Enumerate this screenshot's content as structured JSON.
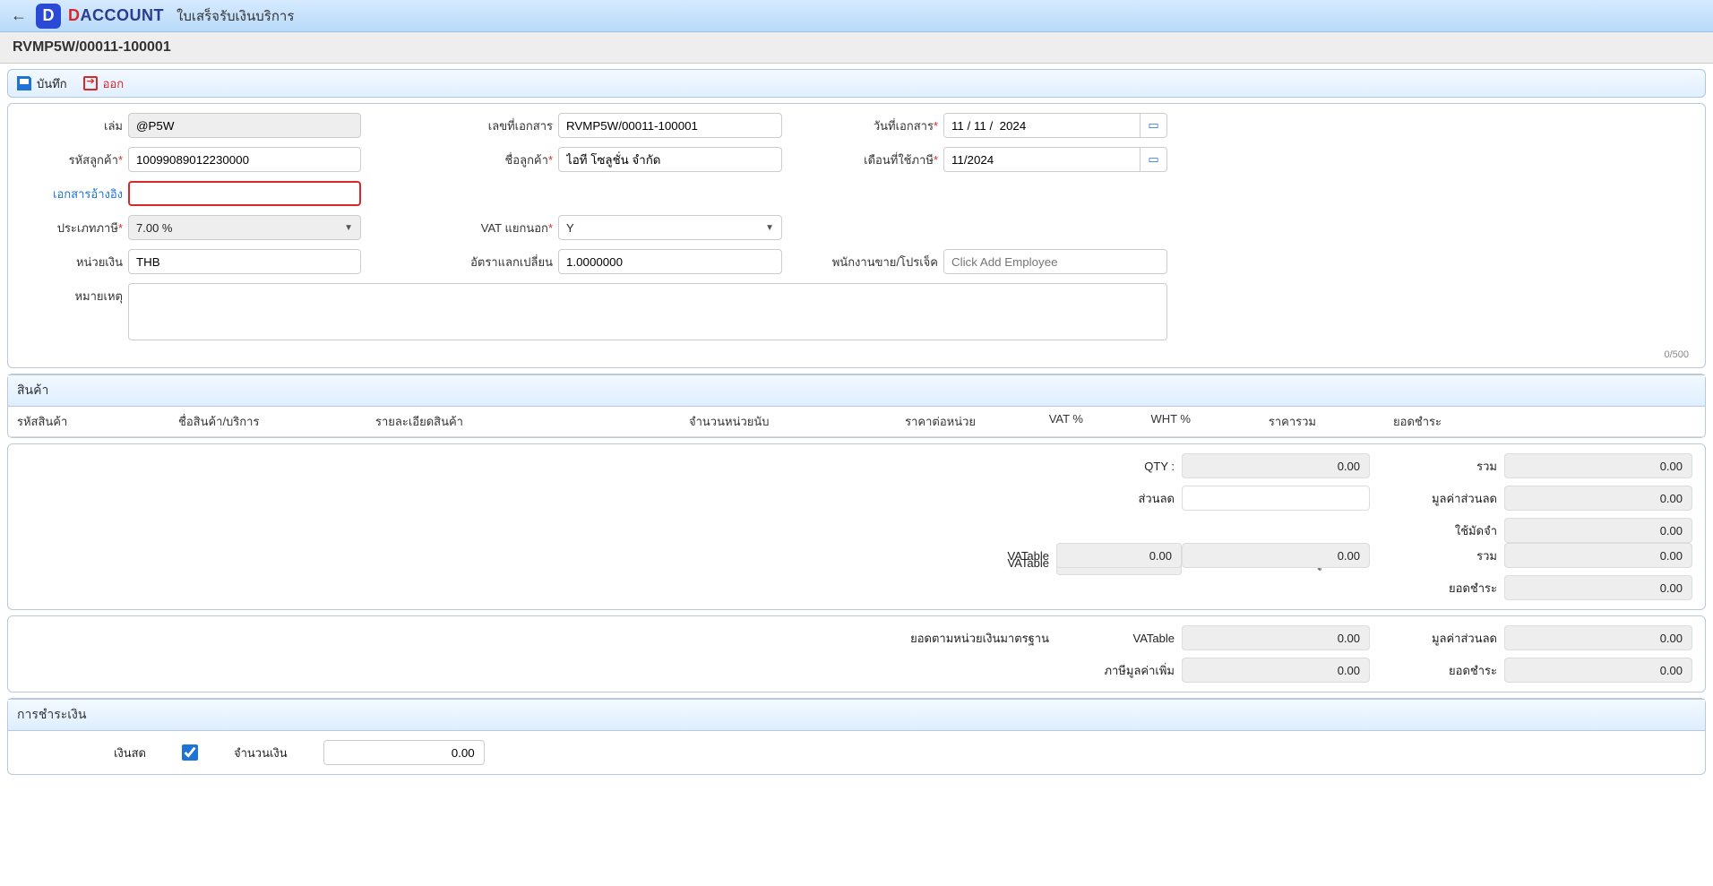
{
  "header": {
    "logo_letter": "D",
    "wordmark_d": "D",
    "wordmark_rest": "ACCOUNT",
    "page_title": "ใบเสร็จรับเงินบริการ"
  },
  "subhead": "RVMP5W/00011-100001",
  "toolbar": {
    "save": "บันทึก",
    "exit": "ออก"
  },
  "form": {
    "book_lbl": "เล่ม",
    "book_val": "@P5W",
    "docno_lbl": "เลขที่เอกสาร",
    "docno_val": "RVMP5W/00011-100001",
    "docdate_lbl": "วันที่เอกสาร",
    "docdate_val": "11 / 11 /  2024",
    "custcode_lbl": "รหัสลูกค้า",
    "custcode_val": "10099089012230000",
    "custname_lbl": "ชื่อลูกค้า",
    "custname_val": "ไอที โซลูชั่น จำกัด",
    "taxmonth_lbl": "เดือนที่ใช้ภาษี",
    "taxmonth_val": "11/2024",
    "ref_lbl": "เอกสารอ้างอิง",
    "ref_val": "",
    "taxtype_lbl": "ประเภทภาษี",
    "taxtype_val": "7.00 %",
    "vatsep_lbl": "VAT แยกนอก",
    "vatsep_val": "Y",
    "currency_lbl": "หน่วยเงิน",
    "currency_val": "THB",
    "rate_lbl": "อัตราแลกเปลี่ยน",
    "rate_val": "1.0000000",
    "sales_lbl": "พนักงานขาย/โปรเจ็ค",
    "sales_ph": "Click Add Employee",
    "remark_lbl": "หมายเหตุ",
    "remark_val": "",
    "counter": "0/500"
  },
  "items": {
    "section": "สินค้า",
    "cols": {
      "code": "รหัสสินค้า",
      "name": "ชื่อสินค้า/บริการ",
      "detail": "รายละเอียดสินค้า",
      "qty": "จำนวน",
      "unit": "หน่วยนับ",
      "price": "ราคาต่อหน่วย",
      "vat": "VAT %",
      "wht": "WHT %",
      "total": "ราคารวม",
      "pay": "ยอดชำระ"
    }
  },
  "totals": {
    "qty_lbl": "QTY :",
    "qty": "0.00",
    "sum_lbl": "รวม",
    "sum": "0.00",
    "disc_lbl": "ส่วนลด",
    "disc_in": "",
    "discamt_lbl": "มูลค่าส่วนลด",
    "discamt": "0.00",
    "dep_lbl": "ใช้มัดจำ",
    "dep": "0.00",
    "vatable_lbl": "VATable",
    "vatable": "0.00",
    "vat_lbl": "ภาษีมูลค่าเพิ่ม",
    "vat": "0.00",
    "sum2_lbl": "รวม",
    "sum2": "0.00",
    "net_lbl": "ยอดชำระ",
    "net": "0.00",
    "base_lead": "ยอดตามหน่วยเงินมาตรฐาน",
    "b_vatable_lbl": "VATable",
    "b_vatable": "0.00",
    "b_discamt_lbl": "มูลค่าส่วนลด",
    "b_discamt": "0.00",
    "b_vat_lbl": "ภาษีมูลค่าเพิ่ม",
    "b_vat": "0.00",
    "b_net_lbl": "ยอดชำระ",
    "b_net": "0.00"
  },
  "payment": {
    "section": "การชำระเงิน",
    "cash_lbl": "เงินสด",
    "cash_checked": true,
    "amount_lbl": "จำนวนเงิน",
    "amount": "0.00"
  }
}
